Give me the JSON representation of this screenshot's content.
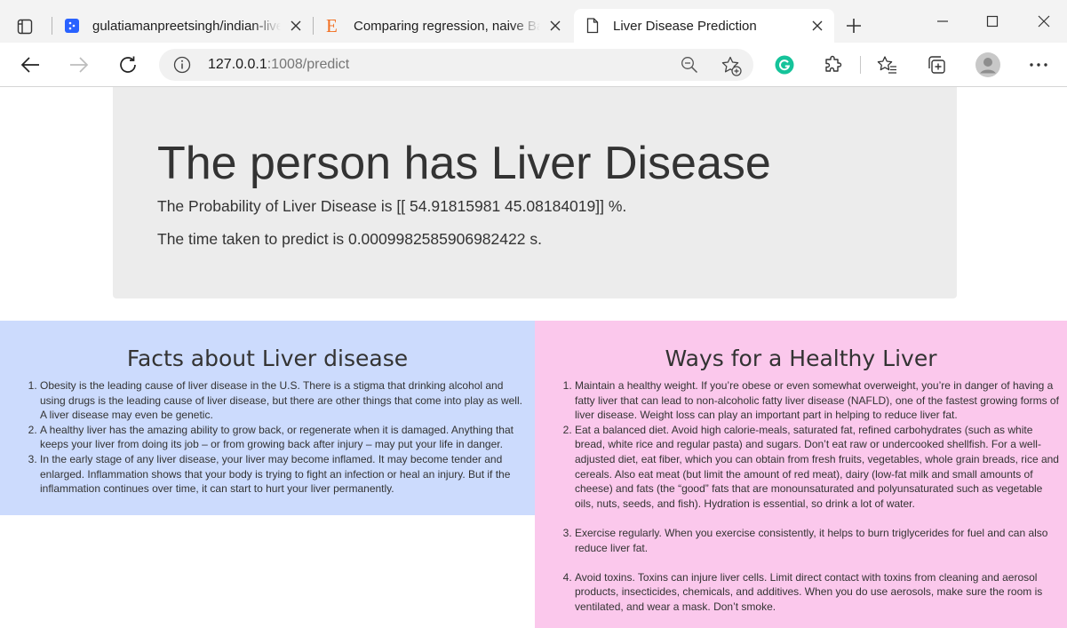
{
  "browser": {
    "tabs": [
      {
        "title": "gulatiamanpreetsingh/indian-liver-patient-records",
        "favicon": "github-like-square-icon"
      },
      {
        "title": "Comparing regression, naive Bayes and SVM",
        "favicon": "letter-e-icon"
      },
      {
        "title": "Liver Disease Prediction",
        "favicon": "page-icon"
      }
    ],
    "address": {
      "host": "127.0.0.1",
      "rest": ":1008/predict"
    }
  },
  "page": {
    "heading": "The person has Liver Disease",
    "probability_text": "The Probability of Liver Disease is [[ 54.91815981 45.08184019]] %.",
    "time_text": "The time taken to predict is 0.0009982585906982422 s."
  },
  "facts": {
    "title": "Facts about Liver disease",
    "items": [
      "Obesity is the leading cause of liver disease in the U.S. There is a stigma that drinking alcohol and using drugs is the leading cause of liver disease, but there are other things that come into play as well. A liver disease may even be genetic.",
      "A healthy liver has the amazing ability to grow back, or regenerate when it is damaged. Anything that keeps your liver from doing its job – or from growing back after injury – may put your life in danger.",
      "In the early stage of any liver disease, your liver may become inflamed. It may become tender and enlarged. Inflammation shows that your body is trying to fight an infection or heal an injury. But if the inflammation continues over time, it can start to hurt your liver permanently."
    ]
  },
  "ways": {
    "title": "Ways for a Healthy Liver",
    "items": [
      "Maintain a healthy weight. If you’re obese or even somewhat overweight, you’re in danger of having a fatty liver that can lead to non-alcoholic fatty liver disease (NAFLD), one of the fastest growing forms of liver disease. Weight loss can play an important part in helping to reduce liver fat.",
      "Eat a balanced diet. Avoid high calorie-meals, saturated fat, refined carbohydrates (such as white bread, white rice and regular pasta) and sugars. Don’t eat raw or undercooked shellfish. For a well-adjusted diet, eat fiber, which you can obtain from fresh fruits, vegetables, whole grain breads, rice and cereals. Also eat meat (but limit the amount of red meat), dairy (low-fat milk and small amounts of cheese) and fats (the “good” fats that are monounsaturated and polyunsaturated such as vegetable oils, nuts, seeds, and fish). Hydration is essential, so drink a lot of water.",
      "Exercise regularly. When you exercise consistently, it helps to burn triglycerides for fuel and can also reduce liver fat.",
      "Avoid toxins. Toxins can injure liver cells. Limit direct contact with toxins from cleaning and aerosol products, insecticides, chemicals, and additives. When you do use aerosols, make sure the room is ventilated, and wear a mask. Don’t smoke."
    ]
  },
  "colors": {
    "facts_bg": "#ccdbfd",
    "ways_bg": "#fbc8ec",
    "jumbotron_bg": "#ececec",
    "grammarly": "#15c39a"
  }
}
